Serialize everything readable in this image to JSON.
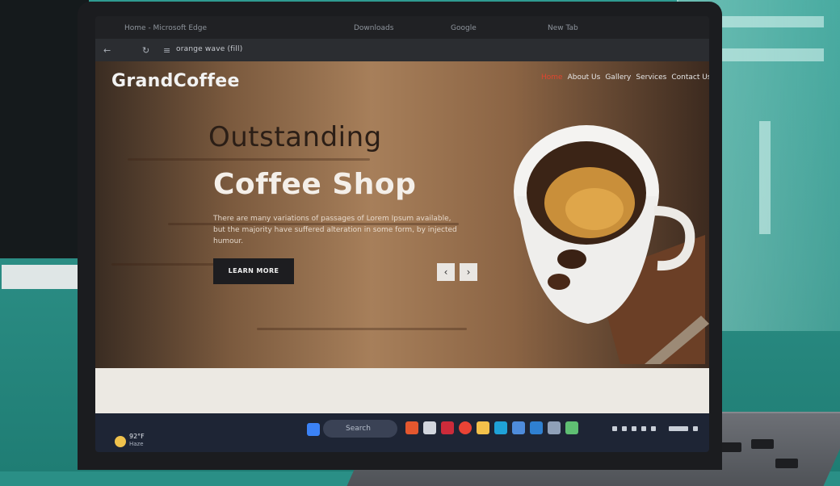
{
  "browser": {
    "tabs": [
      "Home - Microsoft Edge",
      "Downloads",
      "Google",
      "New Tab"
    ],
    "url": "orange wave (fill)",
    "back_icon": "back-arrow-icon",
    "refresh_icon": "refresh-icon"
  },
  "site": {
    "brand": "GrandCoffee",
    "nav": [
      "Home",
      "About Us",
      "Gallery",
      "Services",
      "Contact Us"
    ],
    "hero_subtitle": "Outstanding",
    "hero_title": "Coffee Shop",
    "hero_text": "There are many variations of passages of Lorem Ipsum available, but the majority have suffered alteration in some form, by injected humour.",
    "cta_label": "LEARN MORE",
    "prev_arrow": "‹",
    "next_arrow": "›"
  },
  "taskbar": {
    "weather_temp": "92°F",
    "weather_condition": "Haze",
    "search_placeholder": "Search"
  },
  "colors": {
    "nav_active": "#e0452f",
    "site_dark": "#1d1d20",
    "desk_teal": "#2a8f86"
  }
}
